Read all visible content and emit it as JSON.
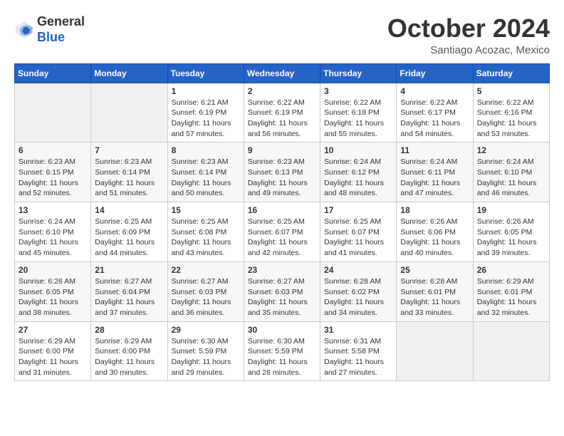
{
  "header": {
    "logo": {
      "line1": "General",
      "line2": "Blue"
    },
    "title": "October 2024",
    "location": "Santiago Acozac, Mexico"
  },
  "weekdays": [
    "Sunday",
    "Monday",
    "Tuesday",
    "Wednesday",
    "Thursday",
    "Friday",
    "Saturday"
  ],
  "weeks": [
    [
      {
        "day": "",
        "info": ""
      },
      {
        "day": "",
        "info": ""
      },
      {
        "day": "1",
        "info": "Sunrise: 6:21 AM\nSunset: 6:19 PM\nDaylight: 11 hours and 57 minutes."
      },
      {
        "day": "2",
        "info": "Sunrise: 6:22 AM\nSunset: 6:19 PM\nDaylight: 11 hours and 56 minutes."
      },
      {
        "day": "3",
        "info": "Sunrise: 6:22 AM\nSunset: 6:18 PM\nDaylight: 11 hours and 55 minutes."
      },
      {
        "day": "4",
        "info": "Sunrise: 6:22 AM\nSunset: 6:17 PM\nDaylight: 11 hours and 54 minutes."
      },
      {
        "day": "5",
        "info": "Sunrise: 6:22 AM\nSunset: 6:16 PM\nDaylight: 11 hours and 53 minutes."
      }
    ],
    [
      {
        "day": "6",
        "info": "Sunrise: 6:23 AM\nSunset: 6:15 PM\nDaylight: 11 hours and 52 minutes."
      },
      {
        "day": "7",
        "info": "Sunrise: 6:23 AM\nSunset: 6:14 PM\nDaylight: 11 hours and 51 minutes."
      },
      {
        "day": "8",
        "info": "Sunrise: 6:23 AM\nSunset: 6:14 PM\nDaylight: 11 hours and 50 minutes."
      },
      {
        "day": "9",
        "info": "Sunrise: 6:23 AM\nSunset: 6:13 PM\nDaylight: 11 hours and 49 minutes."
      },
      {
        "day": "10",
        "info": "Sunrise: 6:24 AM\nSunset: 6:12 PM\nDaylight: 11 hours and 48 minutes."
      },
      {
        "day": "11",
        "info": "Sunrise: 6:24 AM\nSunset: 6:11 PM\nDaylight: 11 hours and 47 minutes."
      },
      {
        "day": "12",
        "info": "Sunrise: 6:24 AM\nSunset: 6:10 PM\nDaylight: 11 hours and 46 minutes."
      }
    ],
    [
      {
        "day": "13",
        "info": "Sunrise: 6:24 AM\nSunset: 6:10 PM\nDaylight: 11 hours and 45 minutes."
      },
      {
        "day": "14",
        "info": "Sunrise: 6:25 AM\nSunset: 6:09 PM\nDaylight: 11 hours and 44 minutes."
      },
      {
        "day": "15",
        "info": "Sunrise: 6:25 AM\nSunset: 6:08 PM\nDaylight: 11 hours and 43 minutes."
      },
      {
        "day": "16",
        "info": "Sunrise: 6:25 AM\nSunset: 6:07 PM\nDaylight: 11 hours and 42 minutes."
      },
      {
        "day": "17",
        "info": "Sunrise: 6:25 AM\nSunset: 6:07 PM\nDaylight: 11 hours and 41 minutes."
      },
      {
        "day": "18",
        "info": "Sunrise: 6:26 AM\nSunset: 6:06 PM\nDaylight: 11 hours and 40 minutes."
      },
      {
        "day": "19",
        "info": "Sunrise: 6:26 AM\nSunset: 6:05 PM\nDaylight: 11 hours and 39 minutes."
      }
    ],
    [
      {
        "day": "20",
        "info": "Sunrise: 6:26 AM\nSunset: 6:05 PM\nDaylight: 11 hours and 38 minutes."
      },
      {
        "day": "21",
        "info": "Sunrise: 6:27 AM\nSunset: 6:04 PM\nDaylight: 11 hours and 37 minutes."
      },
      {
        "day": "22",
        "info": "Sunrise: 6:27 AM\nSunset: 6:03 PM\nDaylight: 11 hours and 36 minutes."
      },
      {
        "day": "23",
        "info": "Sunrise: 6:27 AM\nSunset: 6:03 PM\nDaylight: 11 hours and 35 minutes."
      },
      {
        "day": "24",
        "info": "Sunrise: 6:28 AM\nSunset: 6:02 PM\nDaylight: 11 hours and 34 minutes."
      },
      {
        "day": "25",
        "info": "Sunrise: 6:28 AM\nSunset: 6:01 PM\nDaylight: 11 hours and 33 minutes."
      },
      {
        "day": "26",
        "info": "Sunrise: 6:29 AM\nSunset: 6:01 PM\nDaylight: 11 hours and 32 minutes."
      }
    ],
    [
      {
        "day": "27",
        "info": "Sunrise: 6:29 AM\nSunset: 6:00 PM\nDaylight: 11 hours and 31 minutes."
      },
      {
        "day": "28",
        "info": "Sunrise: 6:29 AM\nSunset: 6:00 PM\nDaylight: 11 hours and 30 minutes."
      },
      {
        "day": "29",
        "info": "Sunrise: 6:30 AM\nSunset: 5:59 PM\nDaylight: 11 hours and 29 minutes."
      },
      {
        "day": "30",
        "info": "Sunrise: 6:30 AM\nSunset: 5:59 PM\nDaylight: 11 hours and 28 minutes."
      },
      {
        "day": "31",
        "info": "Sunrise: 6:31 AM\nSunset: 5:58 PM\nDaylight: 11 hours and 27 minutes."
      },
      {
        "day": "",
        "info": ""
      },
      {
        "day": "",
        "info": ""
      }
    ]
  ]
}
